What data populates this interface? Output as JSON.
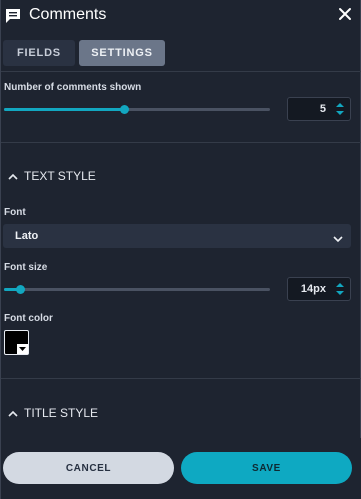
{
  "header": {
    "title": "Comments",
    "icon": "comment-icon",
    "close_icon": "close-icon"
  },
  "tabs": [
    {
      "label": "FIELDS",
      "active": false
    },
    {
      "label": "SETTINGS",
      "active": true
    }
  ],
  "comments_count": {
    "label": "Number of comments shown",
    "value": "5",
    "fraction": 0.45
  },
  "text_style": {
    "title": "TEXT STYLE",
    "expanded": true,
    "font": {
      "label": "Font",
      "value": "Lato"
    },
    "font_size": {
      "label": "Font size",
      "value": "14px",
      "fraction": 0.06
    },
    "font_color": {
      "label": "Font color",
      "value": "#000000"
    }
  },
  "title_style": {
    "title": "TITLE STYLE",
    "expanded": false
  },
  "footer": {
    "cancel_label": "CANCEL",
    "save_label": "SAVE"
  },
  "colors": {
    "accent": "#12a7c0",
    "background": "#1e2430",
    "save_button": "#0ea9c2",
    "cancel_button": "#d3d9e2"
  }
}
